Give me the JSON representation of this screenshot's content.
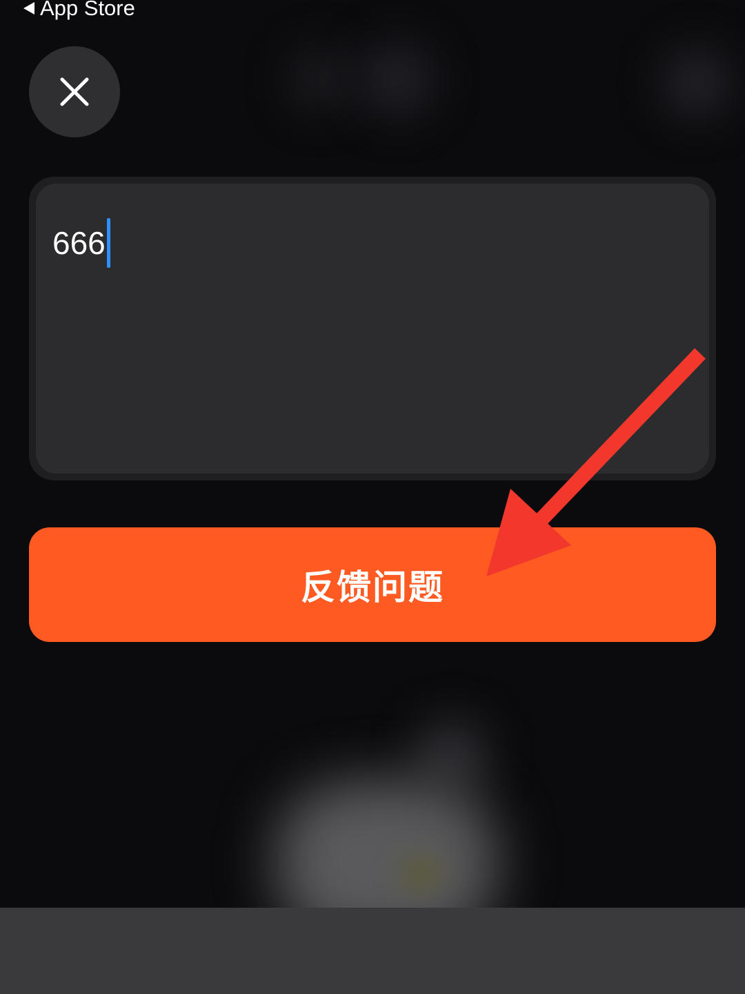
{
  "status_bar": {
    "back_label": "App Store"
  },
  "icons": {
    "back": "back-triangle-icon",
    "close": "close-icon"
  },
  "feedback_input": {
    "value": "666"
  },
  "submit_button": {
    "label": "反馈问题"
  },
  "colors": {
    "background": "#0b0a0d",
    "input_background": "#2c2c2e",
    "button_accent": "#ff5a22",
    "caret": "#2f8fff",
    "annotation_arrow": "#f2382c"
  }
}
